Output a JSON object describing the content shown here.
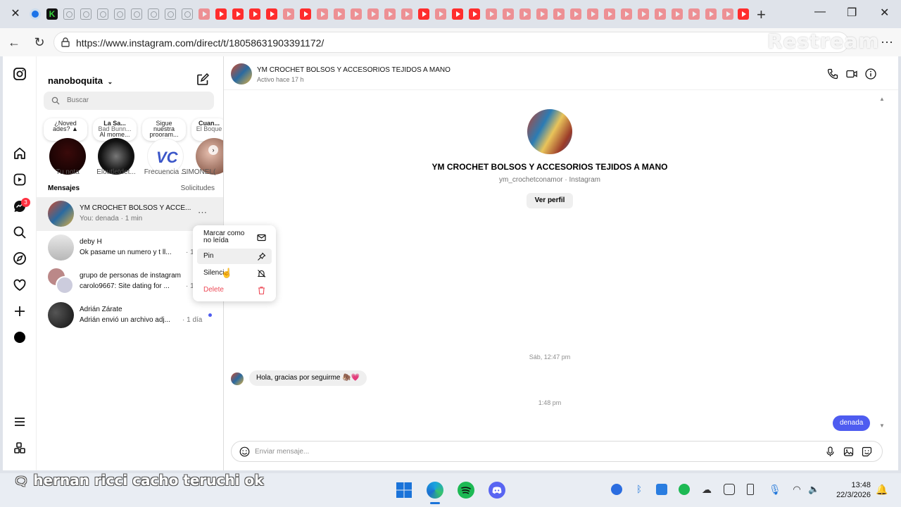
{
  "browser": {
    "url": "https://www.instagram.com/direct/t/18058631903391172/",
    "watermark": "Restream"
  },
  "sidebar": {
    "notification_badge": "3"
  },
  "inbox": {
    "username": "nanoboquita",
    "search_placeholder": "Buscar",
    "notes": [
      {
        "line1": "¿Noved",
        "line2": "ades? ▲",
        "line3": ""
      },
      {
        "line1": "La Sa...",
        "line2": "Bad Bunn...",
        "line3": "Al mome..."
      },
      {
        "line1": "Sigue",
        "line2": "nuestra",
        "line3": "prooram..."
      },
      {
        "line1": "Cuan...",
        "line2": "El Boque",
        "line3": ""
      }
    ],
    "stories": [
      "Tu nota",
      "Eloutletdet...",
      "Frecuencia ...",
      "SIMONEL("
    ],
    "messages_heading": "Mensajes",
    "requests_label": "Solicitudes",
    "conversations": [
      {
        "name": "YM CROCHET BOLSOS Y ACCE...",
        "preview": "You: denada · 1 min"
      },
      {
        "name": "deby H",
        "preview": "Ok pasame un numero y t ll...",
        "time": "· 1"
      },
      {
        "name": "grupo de personas de instagram",
        "preview": "carolo9667: Site dating for ...",
        "time": "· 1"
      },
      {
        "name": "Adrián Zárate",
        "preview": "Adrián envió un archivo adj...",
        "time": "· 1 día"
      }
    ],
    "context_menu": {
      "mark_unread_1": "Marcar como",
      "mark_unread_2": "no leída",
      "pin": "Pin",
      "mute": "Silenci",
      "delete": "Delete"
    }
  },
  "chat": {
    "name": "YM CROCHET BOLSOS Y ACCESORIOS TEJIDOS A MANO",
    "status": "Activo hace 17 h",
    "handle": "ym_crochetconamor · Instagram",
    "view_profile": "Ver perfil",
    "timestamp1": "Sáb, 12:47 pm",
    "incoming": "Hola, gracias por seguirme 🦣💗",
    "timestamp2": "1:48 pm",
    "outgoing": "denada",
    "composer_placeholder": "Enviar mensaje..."
  },
  "caption": "hernan ricci cacho teruchi ok",
  "taskbar": {
    "time": "13:48",
    "date": "22/3/2026"
  }
}
